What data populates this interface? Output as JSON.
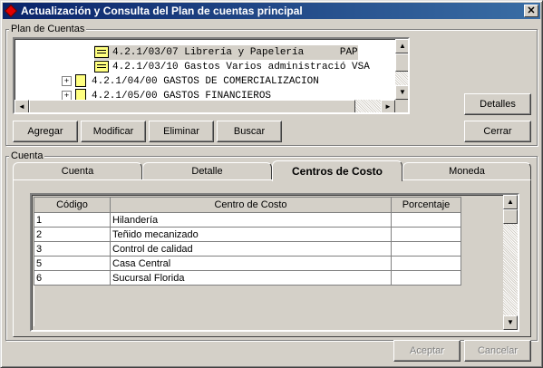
{
  "window": {
    "title": "Actualización y Consulta del Plan de cuentas principal",
    "close_glyph": "✕"
  },
  "plan_group": {
    "label": "Plan de Cuentas"
  },
  "tree": {
    "rows": [
      {
        "text": "4.2.1/03/07 Librería y Papelería      PAP",
        "selected": true
      },
      {
        "text": "4.2.1/03/10 Gastos Varios administració VSA",
        "selected": false
      },
      {
        "text": "4.2.1/04/00 GASTOS DE COMERCIALIZACION",
        "selected": false
      },
      {
        "text": "4.2.1/05/00 GASTOS FINANCIEROS",
        "selected": false
      }
    ],
    "expand_glyph": "+"
  },
  "buttons": {
    "agregar": "Agregar",
    "modificar": "Modificar",
    "eliminar": "Eliminar",
    "buscar": "Buscar",
    "detalles": "Detalles",
    "cerrar": "Cerrar",
    "aceptar": "Aceptar",
    "cancelar": "Cancelar"
  },
  "cuenta_group": {
    "label": "Cuenta"
  },
  "tabs": [
    {
      "label": "Cuenta",
      "active": false
    },
    {
      "label": "Detalle",
      "active": false
    },
    {
      "label": "Centros de Costo",
      "active": true
    },
    {
      "label": "Moneda",
      "active": false
    }
  ],
  "grid": {
    "columns": [
      "Código",
      "Centro de Costo",
      "Porcentaje"
    ],
    "rows": [
      [
        "1",
        "Hilandería",
        ""
      ],
      [
        "2",
        "Teñido mecanizado",
        ""
      ],
      [
        "3",
        "Control de calidad",
        ""
      ],
      [
        "5",
        "Casa Central",
        ""
      ],
      [
        "6",
        "Sucursal Florida",
        ""
      ]
    ]
  },
  "scroll_glyphs": {
    "up": "▲",
    "down": "▼",
    "left": "◄",
    "right": "►"
  }
}
